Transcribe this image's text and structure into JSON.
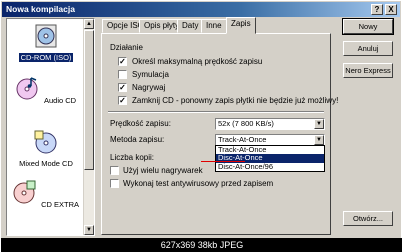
{
  "window": {
    "title": "Nowa kompilacja",
    "help_button": "?",
    "close_button": "X"
  },
  "left_list": {
    "items": [
      {
        "label": "CD-ROM (ISO)",
        "selected": true
      },
      {
        "label": "Audio CD",
        "selected": false
      },
      {
        "label": "Mixed Mode CD",
        "selected": false
      },
      {
        "label": "CD EXTRA",
        "selected": false
      }
    ]
  },
  "tabs": [
    {
      "label": "Opcje ISO",
      "active": false
    },
    {
      "label": "Opis płyty",
      "active": false
    },
    {
      "label": "Daty",
      "active": false
    },
    {
      "label": "Inne",
      "active": false
    },
    {
      "label": "Zapis",
      "active": true
    }
  ],
  "panel": {
    "section_title": "Działanie",
    "checkboxes": [
      {
        "label": "Określ maksymalną prędkość zapisu",
        "checked": true
      },
      {
        "label": "Symulacja",
        "checked": false
      },
      {
        "label": "Nagrywaj",
        "checked": true
      },
      {
        "label": "Zamknij CD - ponowny zapis płytki nie będzie już możliwy!",
        "checked": true
      }
    ],
    "speed_label": "Prędkość zapisu:",
    "speed_value": "52x (7 800 KB/s)",
    "method_label": "Metoda zapisu:",
    "method_value": "Track-At-Once",
    "method_options": [
      "Track-At-Once",
      "Disc-At-Once",
      "Disc-At-Once/96"
    ],
    "method_highlighted": "Disc-At-Once",
    "copies_label": "Liczba kopii:",
    "multi_burner_label": "Użyj wielu nagrywarek",
    "antivirus_label": "Wykonaj test antywirusowy przed zapisem"
  },
  "buttons": {
    "new": "Nowy",
    "cancel": "Anuluj",
    "express": "Nero Express",
    "open": "Otwórz..."
  },
  "caption": "627x369  38kb  JPEG"
}
